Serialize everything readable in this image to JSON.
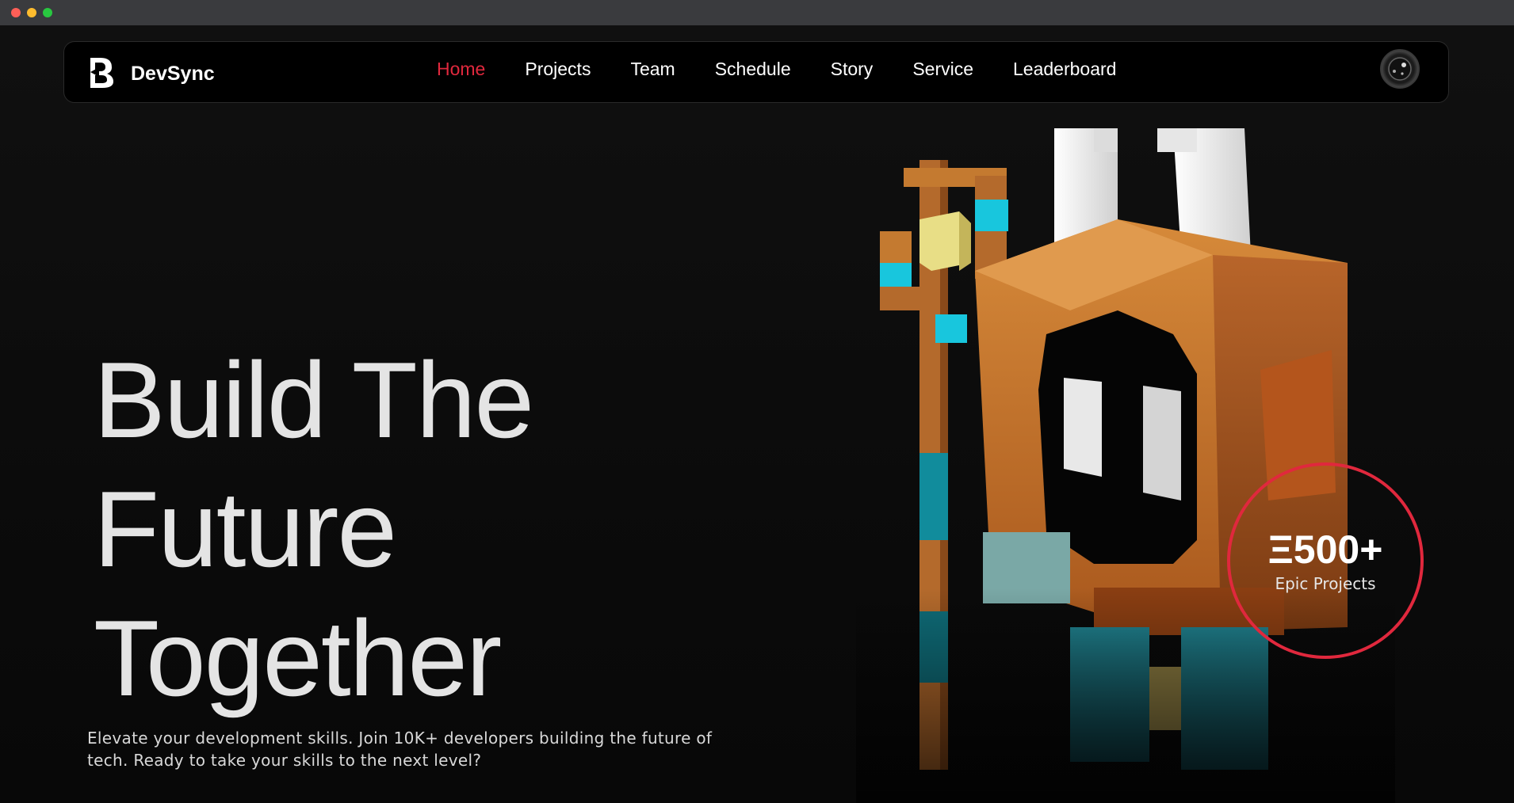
{
  "brand": {
    "name": "DevSync",
    "logo_icon": "devsync-logo-icon"
  },
  "nav": {
    "items": [
      {
        "label": "Home",
        "active": true
      },
      {
        "label": "Projects",
        "active": false
      },
      {
        "label": "Team",
        "active": false
      },
      {
        "label": "Schedule",
        "active": false
      },
      {
        "label": "Story",
        "active": false
      },
      {
        "label": "Service",
        "active": false
      },
      {
        "label": "Leaderboard",
        "active": false
      }
    ],
    "avatar_icon": "user-avatar-icon"
  },
  "hero": {
    "title_lines": [
      "Build The",
      "Future",
      "Together"
    ],
    "subtitle": "Elevate your development skills. Join 10K+ developers building the future of tech. Ready to take your skills to the next level?",
    "illustration": "voxel-character-illustration"
  },
  "stat": {
    "value": "Ξ500+",
    "label": "Epic Projects"
  },
  "colors": {
    "accent": "#e0283d",
    "background": "#0d0d0d",
    "text": "#e4e4e4"
  }
}
